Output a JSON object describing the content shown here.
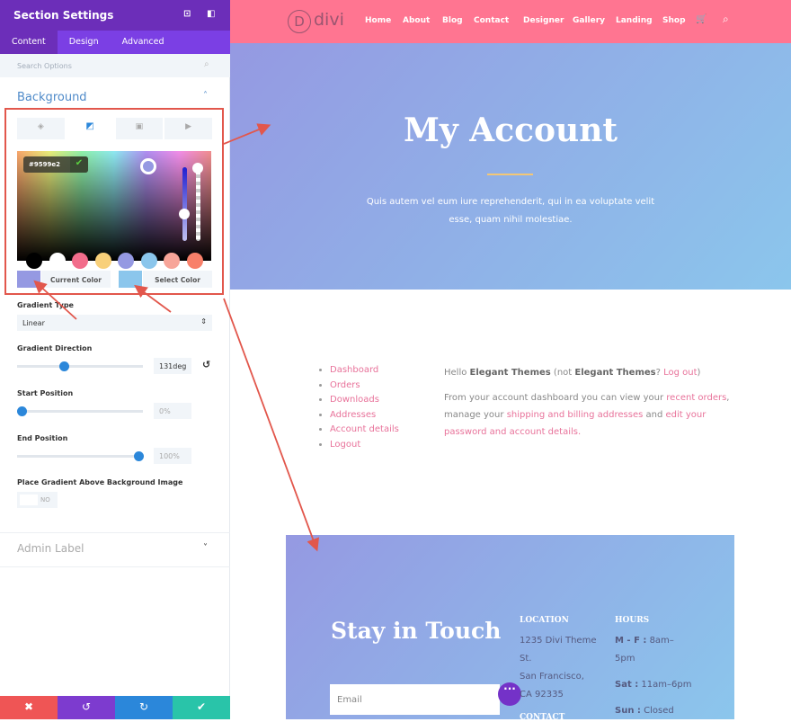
{
  "panel": {
    "title": "Section Settings",
    "tabs": [
      "Content",
      "Design",
      "Advanced"
    ],
    "search_placeholder": "Search Options",
    "background_title": "Background",
    "hex": "#9599e2",
    "current_color": "Current Color",
    "select_color": "Select Color",
    "swatches": [
      "#000000",
      "#ffffff",
      "#f26d8b",
      "#f8d07a",
      "#9599e2",
      "#8bc6ec",
      "#f7a599",
      "#f8806a"
    ],
    "gradient_type_label": "Gradient Type",
    "gradient_type": "Linear",
    "direction_label": "Gradient Direction",
    "direction": "131deg",
    "direction_value": 131,
    "start_label": "Start Position",
    "start": "0%",
    "end_label": "End Position",
    "end": "100%",
    "place_label": "Place Gradient Above Background Image",
    "toggle": "NO",
    "admin_label": "Admin Label",
    "bottom_colors": [
      "#ef5555",
      "#7d3bcf",
      "#2b87da",
      "#29c4a9"
    ]
  },
  "site": {
    "logo": "divi",
    "nav": [
      "Home",
      "About",
      "Blog",
      "Contact",
      "Designer",
      "Gallery",
      "Landing",
      "Shop"
    ],
    "hero_title": "My Account",
    "hero_text1": "Quis autem vel eum iure reprehenderit, qui in ea voluptate velit",
    "hero_text2": "esse, quam nihil molestiae.",
    "account_links": [
      "Dashboard",
      "Orders",
      "Downloads",
      "Addresses",
      "Account details",
      "Logout"
    ],
    "hello": "Hello ",
    "user": "Elegant Themes",
    "not": " (not ",
    "q": "? ",
    "logout": "Log out",
    "close": ")",
    "p1": "From your account dashboard you can view your ",
    "recent": "recent",
    "orders": "orders",
    "p2": ", manage your ",
    "shipping": "shipping and billing addresses",
    "p3": " and ",
    "edit": "edit",
    "pw": "your password and account details.",
    "stay": "Stay in Touch",
    "email_placeholder": "Email",
    "location": "LOCATION",
    "loc_lines": [
      "1235 Divi Theme",
      "St.",
      "San Francisco,",
      "CA 92335"
    ],
    "contact": "CONTACT",
    "hours": "HOURS",
    "mf": "M - F :",
    "mf_v": " 8am–",
    "mf_v2": "5pm",
    "sat": "Sat :",
    "sat_v": " 11am–6pm",
    "sun": "Sun :",
    "sun_v": " Closed"
  }
}
